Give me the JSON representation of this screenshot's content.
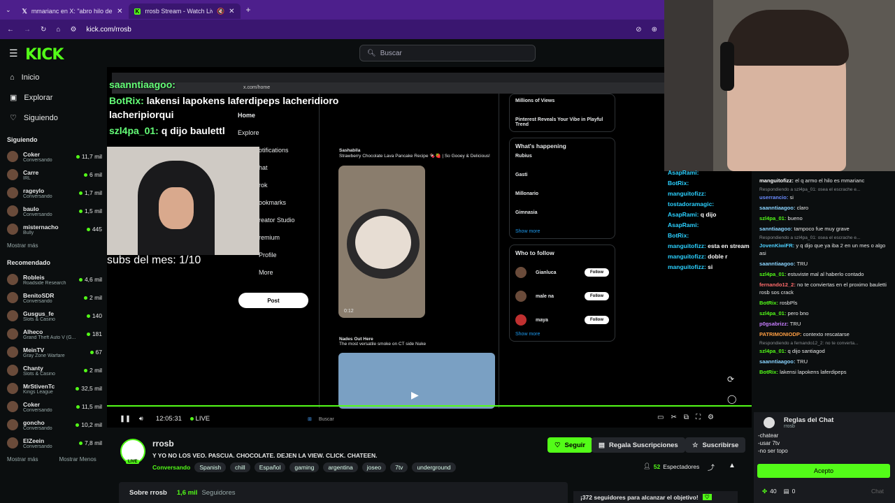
{
  "browser": {
    "tabs": [
      {
        "icon": "x-logo-icon",
        "title": "mmarianc en X: \"abro hilo de m",
        "active": false
      },
      {
        "icon": "kick-favicon-icon",
        "title": "rrosb Stream - Watch Live o",
        "active": true
      }
    ],
    "url": "kick.com/rrosb"
  },
  "header": {
    "logo": "KICK",
    "search_placeholder": "Buscar"
  },
  "sidebar": {
    "nav": [
      {
        "icon": "home-icon",
        "label": "Inicio"
      },
      {
        "icon": "compass-icon",
        "label": "Explorar"
      },
      {
        "icon": "heart-icon",
        "label": "Siguiendo"
      }
    ],
    "following_title": "Siguiendo",
    "following": [
      {
        "name": "Coker",
        "category": "Conversando",
        "viewers": "11,7 mil"
      },
      {
        "name": "Carre",
        "category": "IRL",
        "viewers": "6 mil"
      },
      {
        "name": "rageylo",
        "category": "Conversando",
        "viewers": "1,7 mil"
      },
      {
        "name": "baulo",
        "category": "Conversando",
        "viewers": "1,5 mil"
      },
      {
        "name": "misternacho",
        "category": "Bully",
        "viewers": "445"
      }
    ],
    "show_more": "Mostrar más",
    "recommended_title": "Recomendado",
    "recommended": [
      {
        "name": "Robleis",
        "category": "Roadside Research",
        "viewers": "4,6 mil"
      },
      {
        "name": "BenitoSDR",
        "category": "Conversando",
        "viewers": "2 mil"
      },
      {
        "name": "Gusgus_fe",
        "category": "Slots & Casino",
        "viewers": "140"
      },
      {
        "name": "Alheco",
        "category": "Grand Theft Auto V (G...",
        "viewers": "181"
      },
      {
        "name": "MeinTV",
        "category": "Gray Zone Warfare",
        "viewers": "67"
      },
      {
        "name": "Chanty",
        "category": "Slots & Casino",
        "viewers": "2 mil"
      },
      {
        "name": "MrStivenTc",
        "category": "Kings League",
        "viewers": "32,5 mil"
      },
      {
        "name": "Coker",
        "category": "Conversando",
        "viewers": "11,5 mil"
      },
      {
        "name": "goncho",
        "category": "Conversando",
        "viewers": "10,2 mil"
      },
      {
        "name": "ElZeein",
        "category": "Conversando",
        "viewers": "7,8 mil"
      }
    ],
    "show_more_2": "Mostrar más",
    "show_less": "Mostrar Menos"
  },
  "video": {
    "overlay_chat": [
      {
        "user": "saanntiaagoo:",
        "text": ""
      },
      {
        "user": "BotRix:",
        "text": "lakensi lapokens laferdipeps lacheridioro lacheripiorqui"
      },
      {
        "user": "szl4pa_01:",
        "text": "q dijo baulettl"
      }
    ],
    "subs_text": "subs del mes: 1/10",
    "x_url": "x.com/home",
    "x_nav": [
      "Home",
      "Explore",
      "otifications",
      "hat",
      "rok",
      "ookmarks",
      "reator Studio",
      "remium",
      "Profile",
      "More"
    ],
    "x_post_button": "Post",
    "tweet1_author": "Sashabila",
    "tweet1_text": "Strawberry Chocolate Lava Pancake Recipe 🍫🍓 | So Gooey & Delicious!",
    "tweet1_time": "0:12",
    "tweet2_author": "Nades Out Here",
    "tweet2_text": "The most versatile smoke on CT side Nuke",
    "x_right": {
      "trend_top": "Millions of Views",
      "trend_pinterest": "Pinterest Reveals Your Vibe in Playful Trend",
      "happening_title": "What's happening",
      "trends": [
        "Rubius",
        "Gasti",
        "Millonario",
        "Gimnasia"
      ],
      "show_more": "Show more",
      "follow_title": "Who to follow",
      "follows": [
        "Gianluca",
        "male na",
        "maya"
      ],
      "follow_label": "Follow"
    },
    "time": "12:05:31",
    "live_label": "LIVE",
    "taskbar_search": "Buscar"
  },
  "stream_chat_overlay": [
    {
      "user": "AsapRami:",
      "text": ""
    },
    {
      "user": "BotRix:",
      "text": ""
    },
    {
      "user": "manguitofizz:",
      "text": ""
    },
    {
      "user": "tostadoramagic:",
      "text": ""
    },
    {
      "user": "AsapRami:",
      "text": "q dijo"
    },
    {
      "user": "AsapRami:",
      "text": ""
    },
    {
      "user": "BotRix:",
      "text": ""
    },
    {
      "user": "manguitofizz:",
      "text": "esta en stream"
    },
    {
      "user": "manguitofizz:",
      "text": "doble r"
    },
    {
      "user": "manguitofizz:",
      "text": "si"
    }
  ],
  "chat": {
    "messages": [
      {
        "reply": "",
        "user": "manguitofizz:",
        "color": "#ffffff",
        "text": "el q armo el hilo es mmarianc"
      },
      {
        "reply": "Respondiendo a szl4pa_01: osea el escrache e...",
        "user": "userrancio:",
        "color": "#6b8cff",
        "text": "si"
      },
      {
        "reply": "",
        "user": "saanntiaagoo:",
        "color": "#8ad4ff",
        "text": "claro"
      },
      {
        "reply": "",
        "user": "szl4pa_01:",
        "color": "#53fc18",
        "text": "bueno"
      },
      {
        "reply": "",
        "user": "sanntiaagoo:",
        "color": "#8ad4ff",
        "text": "tampoco fue muy grave"
      },
      {
        "reply": "Respondiendo a szl4pa_01: osea el escrache e...",
        "user": "JovenKiwiFR:",
        "color": "#4dd0ff",
        "text": "y q dijo que ya iba 2 en un mes o algo asi"
      },
      {
        "reply": "",
        "user": "saanntiaagoo:",
        "color": "#8ad4ff",
        "text": "TRU"
      },
      {
        "reply": "",
        "user": "szl4pa_01:",
        "color": "#53fc18",
        "text": "estuviste mal al haberlo contado"
      },
      {
        "reply": "",
        "user": "fernando12_2:",
        "color": "#ff6b6b",
        "text": "no te conviertas en el proximo bauletti rosb sos crack"
      },
      {
        "reply": "",
        "user": "BotRix:",
        "color": "#53fc18",
        "text": "rosbPls"
      },
      {
        "reply": "",
        "user": "szl4pa_01:",
        "color": "#53fc18",
        "text": "pero bno"
      },
      {
        "reply": "",
        "user": "p0gsabrizz:",
        "color": "#c77dff",
        "text": "TRU"
      },
      {
        "reply": "",
        "user": "PATRIMONIODP:",
        "color": "#ff9f43",
        "text": "contexto rescatarse"
      },
      {
        "reply": "Respondiendo a fernando12_2: no te converta...",
        "user": "szl4pa_01:",
        "color": "#53fc18",
        "text": "q dijo santiagod"
      },
      {
        "reply": "",
        "user": "saanntiaagoo:",
        "color": "#8ad4ff",
        "text": "TRU"
      },
      {
        "reply": "",
        "user": "BotRix:",
        "color": "#53fc18",
        "text": "lakensi lapokens laferdipeps"
      }
    ],
    "rules_title": "Reglas del Chat",
    "rules_owner": "rrosb",
    "rules": [
      "-chatear",
      "-usar 7tv",
      "-no ser topo"
    ],
    "accept": "Acepto",
    "points": "40",
    "gifts": "0",
    "chat_button": "Chat"
  },
  "channel": {
    "name": "rrosb",
    "title": "Y YO NO LOS VEO. PASCUA. CHOCOLATE. DEJEN LA VIEW. CLICK. CHATEEN.",
    "category": "Conversando",
    "tags": [
      "Spanish",
      "chill",
      "Español",
      "gaming",
      "argentina",
      "joseo",
      "7tv",
      "underground"
    ],
    "follow_button": "Seguir",
    "gift_button": "Regala Suscripciones",
    "subscribe_button": "Suscribirse",
    "viewers": "52",
    "viewers_label": "Espectadores",
    "live_badge": "LIVE",
    "about_label": "Sobre rrosb",
    "followers_count": "1,6 mil",
    "followers_label": "Seguidores",
    "goal_text": "¡372 seguidores para alcanzar el objetivo!"
  },
  "colors": {
    "accent": "#53fc18",
    "browser": "#4d1f8c",
    "bg": "#0b0e0f"
  }
}
